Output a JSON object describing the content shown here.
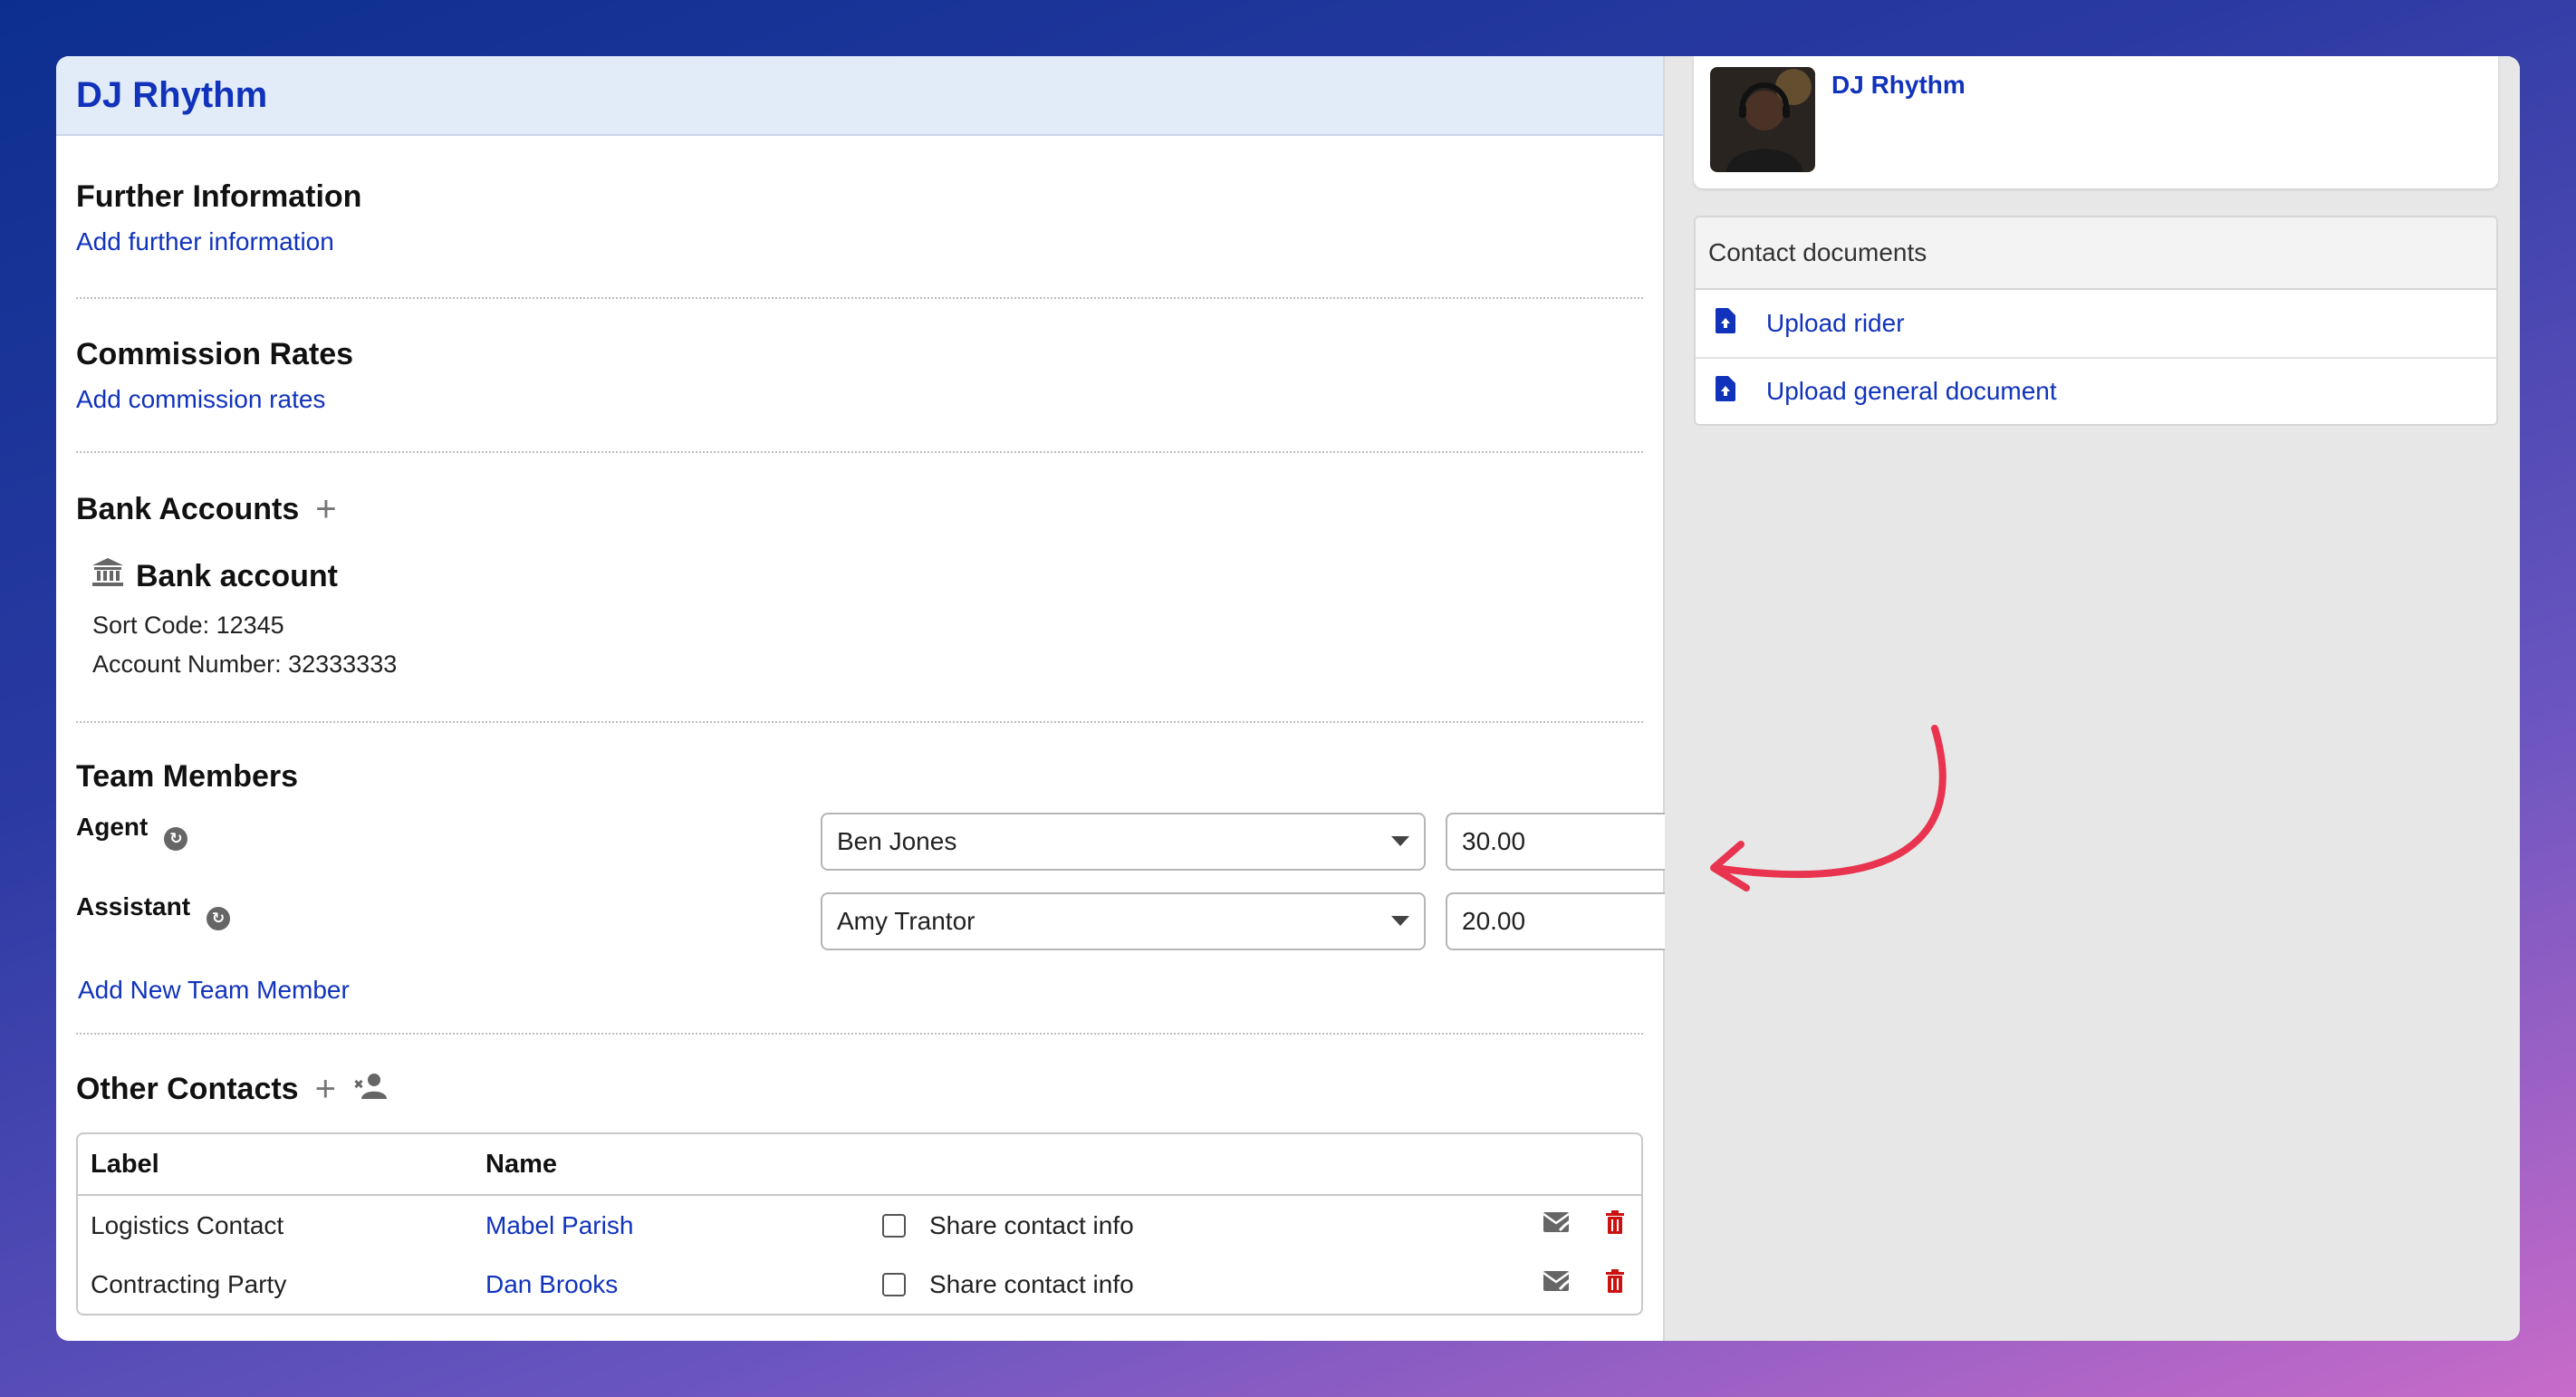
{
  "profile": {
    "title": "DJ Rhythm",
    "card_name": "DJ Rhythm"
  },
  "further_info": {
    "title": "Further Information",
    "link": "Add further information"
  },
  "commission": {
    "title": "Commission Rates",
    "link": "Add commission rates"
  },
  "bank": {
    "title": "Bank Accounts",
    "account_title": "Bank account",
    "sort_code": "Sort Code: 12345",
    "account_number": "Account Number: 32333333"
  },
  "team": {
    "title": "Team Members",
    "members": [
      {
        "role": "Agent",
        "name": "Ben Jones",
        "rate": "30.00"
      },
      {
        "role": "Assistant",
        "name": "Amy Trantor",
        "rate": "20.00"
      }
    ],
    "add_link": "Add New Team Member"
  },
  "other_contacts": {
    "title": "Other Contacts",
    "headers": {
      "label": "Label",
      "name": "Name"
    },
    "rows": [
      {
        "label": "Logistics Contact",
        "name": "Mabel Parish",
        "share": "Share contact info"
      },
      {
        "label": "Contracting Party",
        "name": "Dan Brooks",
        "share": "Share contact info"
      }
    ]
  },
  "documents": {
    "title": "Contact documents",
    "items": [
      "Upload rider",
      "Upload general document"
    ]
  },
  "colors": {
    "accent_blue": "#1133bb",
    "danger_red": "#cc1111",
    "annotation_arrow": "#e8344e"
  }
}
